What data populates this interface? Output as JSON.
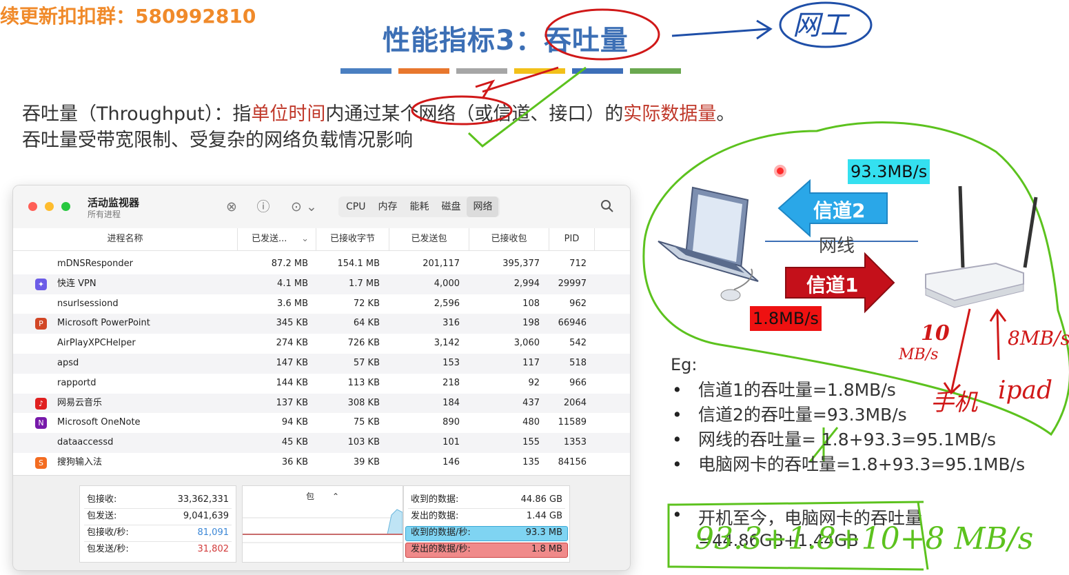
{
  "header": {
    "watermark": "续更新扣扣群：580992810",
    "title": "性能指标3：吞吐量",
    "handwritten_note": "网工",
    "color_bars": [
      "#4a7fc1",
      "#e8772e",
      "#a6a6a6",
      "#f2c019",
      "#3d6fb8",
      "#6aa84f"
    ]
  },
  "definition": {
    "line1_a": "吞吐量（Throughput）：指",
    "line1_hl1": "单位时间",
    "line1_b": "内通过某个网络（或信道、接口）的",
    "line1_hl2": "实际数据量",
    "line1_c": "。",
    "line2": "吞吐量受带宽限制、受复杂的网络负载情况影响"
  },
  "monitor": {
    "title": "活动监视器",
    "subtitle": "所有进程",
    "tabs": [
      {
        "label": "CPU"
      },
      {
        "label": "内存"
      },
      {
        "label": "能耗"
      },
      {
        "label": "磁盘"
      },
      {
        "label": "网络"
      }
    ],
    "columns": {
      "name": "进程名称",
      "sent_bytes": "已发送...",
      "recv_bytes": "已接收字节",
      "sent_packets": "已发送包",
      "recv_packets": "已接收包",
      "pid": "PID"
    },
    "rows": [
      {
        "name": "mDNSResponder",
        "sent": "87.2 MB",
        "recv": "154.1 MB",
        "sp": "201,117",
        "rp": "395,377",
        "pid": "712",
        "icon": ""
      },
      {
        "name": "快连 VPN",
        "sent": "4.1 MB",
        "recv": "1.7 MB",
        "sp": "4,000",
        "rp": "2,994",
        "pid": "29997",
        "icon": "vpn"
      },
      {
        "name": "nsurlsessiond",
        "sent": "3.6 MB",
        "recv": "72 KB",
        "sp": "2,596",
        "rp": "108",
        "pid": "962",
        "icon": ""
      },
      {
        "name": "Microsoft PowerPoint",
        "sent": "345 KB",
        "recv": "64 KB",
        "sp": "316",
        "rp": "198",
        "pid": "66946",
        "icon": "ppt"
      },
      {
        "name": "AirPlayXPCHelper",
        "sent": "274 KB",
        "recv": "726 KB",
        "sp": "3,142",
        "rp": "3,060",
        "pid": "542",
        "icon": ""
      },
      {
        "name": "apsd",
        "sent": "147 KB",
        "recv": "57 KB",
        "sp": "153",
        "rp": "117",
        "pid": "518",
        "icon": ""
      },
      {
        "name": "rapportd",
        "sent": "144 KB",
        "recv": "113 KB",
        "sp": "218",
        "rp": "92",
        "pid": "966",
        "icon": ""
      },
      {
        "name": "网易云音乐",
        "sent": "137 KB",
        "recv": "308 KB",
        "sp": "184",
        "rp": "437",
        "pid": "2064",
        "icon": "music"
      },
      {
        "name": "Microsoft OneNote",
        "sent": "94 KB",
        "recv": "75 KB",
        "sp": "890",
        "rp": "480",
        "pid": "11589",
        "icon": "onenote"
      },
      {
        "name": "dataaccessd",
        "sent": "45 KB",
        "recv": "103 KB",
        "sp": "101",
        "rp": "155",
        "pid": "1353",
        "icon": ""
      },
      {
        "name": "搜狗输入法",
        "sent": "36 KB",
        "recv": "39 KB",
        "sp": "146",
        "rp": "135",
        "pid": "84156",
        "icon": "sogou"
      }
    ],
    "footer": {
      "packets_in_label": "包接收:",
      "packets_in": "33,362,331",
      "packets_out_label": "包发送:",
      "packets_out": "9,041,639",
      "packets_in_sec_label": "包接收/秒:",
      "packets_in_sec": "81,091",
      "packets_out_sec_label": "包发送/秒:",
      "packets_out_sec": "31,802",
      "graph_selector": "包",
      "data_received_label": "收到的数据:",
      "data_received": "44.86 GB",
      "data_sent_label": "发出的数据:",
      "data_sent": "1.44 GB",
      "data_received_sec_label": "收到的数据/秒:",
      "data_received_sec": "93.3 MB",
      "data_sent_sec_label": "发出的数据/秒:",
      "data_sent_sec": "1.8 MB"
    }
  },
  "diagram": {
    "channel2": "信道2",
    "channel1": "信道1",
    "cable": "网线",
    "speed_down": "93.3MB/s",
    "speed_up": "1.8MB/s",
    "hand_phone_speed_num": "10",
    "hand_phone_speed_unit": "MB/s",
    "hand_ipad_speed": "8MB/s",
    "hand_phone": "手机",
    "hand_ipad": "ipad"
  },
  "example": {
    "label": "Eg:",
    "bullets": [
      "信道1的吞吐量=1.8MB/s",
      "信道2的吞吐量=93.3MB/s",
      "网线的吞吐量= 1.8+93.3=95.1MB/s",
      "电脑网卡的吞吐量=1.8+93.3=95.1MB/s"
    ],
    "bullet5_a": "开机至今，电脑网卡的吞吐量",
    "bullet5_b": "=44.86GB+1.44GB",
    "hand_formula": "93.3+1.8+10+8 MB/s"
  },
  "colors": {
    "title": "#3c6fb5",
    "highlight": "#c0392b",
    "annotation_red": "#d01818",
    "annotation_green": "#5cc21e",
    "annotation_blue": "#1f4fa8",
    "arrow_blue": "#2aa7e8",
    "arrow_red": "#c4101a"
  }
}
